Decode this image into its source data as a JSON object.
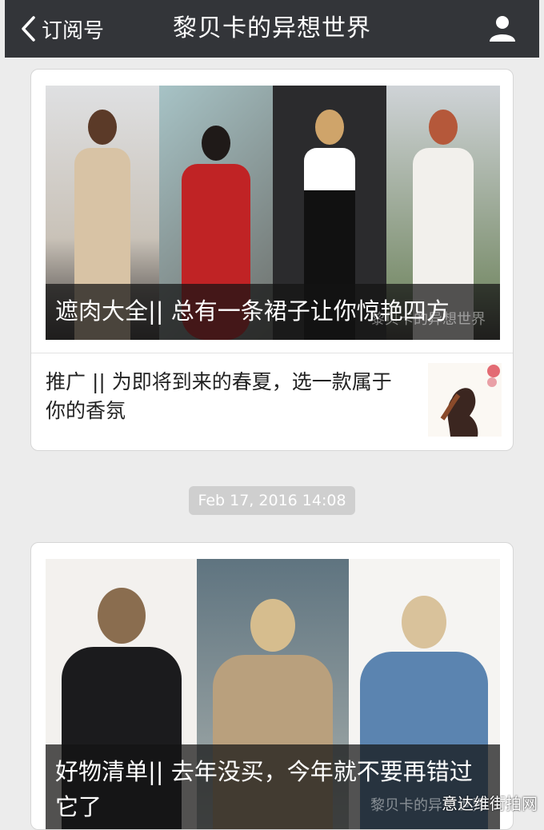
{
  "nav": {
    "back_label": "订阅号",
    "title": "黎贝卡的异想世界"
  },
  "article1": {
    "cover_title": "遮肉大全|| 总有一条裙子让你惊艳四方",
    "watermark": "黎贝卡的异想世界",
    "sub_title": "推广 || 为即将到来的春夏，选一款属于你的香氛"
  },
  "timestamp": "Feb 17, 2016 14:08",
  "article2": {
    "cover_title": "好物清单|| 去年没买，今年就不要再错过它了",
    "watermark": "黎贝卡的异想世界"
  },
  "site_watermark": "意达维街拍网",
  "colors": {
    "nav_bg": "#333539",
    "page_bg": "#ececec",
    "time_bg": "#cfcfcf"
  }
}
